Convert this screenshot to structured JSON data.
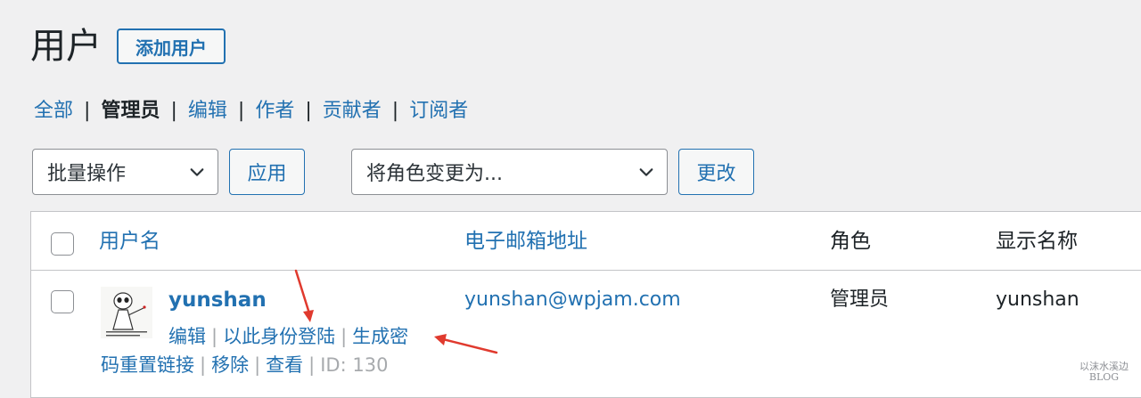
{
  "header": {
    "title": "用户",
    "add_new_label": "添加用户"
  },
  "filters": {
    "items": [
      {
        "label": "全部",
        "current": false
      },
      {
        "label": "管理员",
        "current": true
      },
      {
        "label": "编辑",
        "current": false
      },
      {
        "label": "作者",
        "current": false
      },
      {
        "label": "贡献者",
        "current": false
      },
      {
        "label": "订阅者",
        "current": false
      }
    ],
    "separator": "|"
  },
  "bulk": {
    "select_value": "批量操作",
    "apply_label": "应用"
  },
  "role_change": {
    "select_value": "将角色变更为...",
    "change_label": "更改"
  },
  "table": {
    "columns": [
      "用户名",
      "电子邮箱地址",
      "角色",
      "显示名称"
    ],
    "rows": [
      {
        "username": "yunshan",
        "email": "yunshan@wpjam.com",
        "role": "管理员",
        "display_name": "yunshan",
        "actions_line1": [
          "编辑",
          "以此身份登陆",
          "生成密"
        ],
        "actions_line2": [
          "码重置链接",
          "移除",
          "查看"
        ],
        "id_text": "ID: 130",
        "action_separator": "|"
      }
    ]
  },
  "watermark": {
    "line1": "以沫水溪边",
    "line2": "BLOG"
  },
  "colors": {
    "link": "#2271b1",
    "annotation_arrow": "#e03a2e",
    "background": "#f0f0f1"
  }
}
